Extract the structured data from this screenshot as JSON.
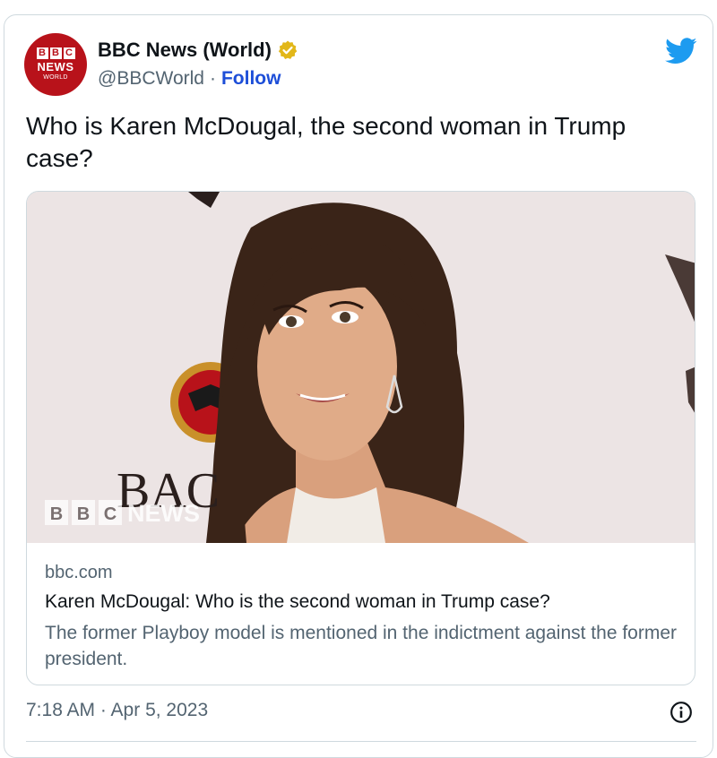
{
  "account": {
    "avatar_blocks": [
      "B",
      "B",
      "C"
    ],
    "avatar_news": "NEWS",
    "avatar_world": "WORLD",
    "name": "BBC News (World)",
    "handle": "@BBCWorld",
    "separator": "·",
    "follow_label": "Follow"
  },
  "tweet": {
    "text": "Who is Karen McDougal, the second woman in Trump case?"
  },
  "link_card": {
    "image_watermark_blocks": [
      "B",
      "B",
      "C"
    ],
    "image_watermark_news": "NEWS",
    "image_backdrop_text": "BAC",
    "domain": "bbc.com",
    "title": "Karen McDougal: Who is the second woman in Trump case?",
    "description": "The former Playboy model is mentioned in the indictment against the former president."
  },
  "footer": {
    "timestamp": "7:18 AM · Apr 5, 2023"
  },
  "icons": {
    "verified": "verified-badge-icon",
    "twitter": "twitter-bird-icon",
    "info": "info-icon"
  },
  "colors": {
    "bbc_red": "#b8121a",
    "verified_gold": "#e2b719",
    "twitter_blue": "#1d9bf0",
    "follow_blue": "#1d4ed8",
    "muted_text": "#536471",
    "border": "#cfd9de"
  }
}
